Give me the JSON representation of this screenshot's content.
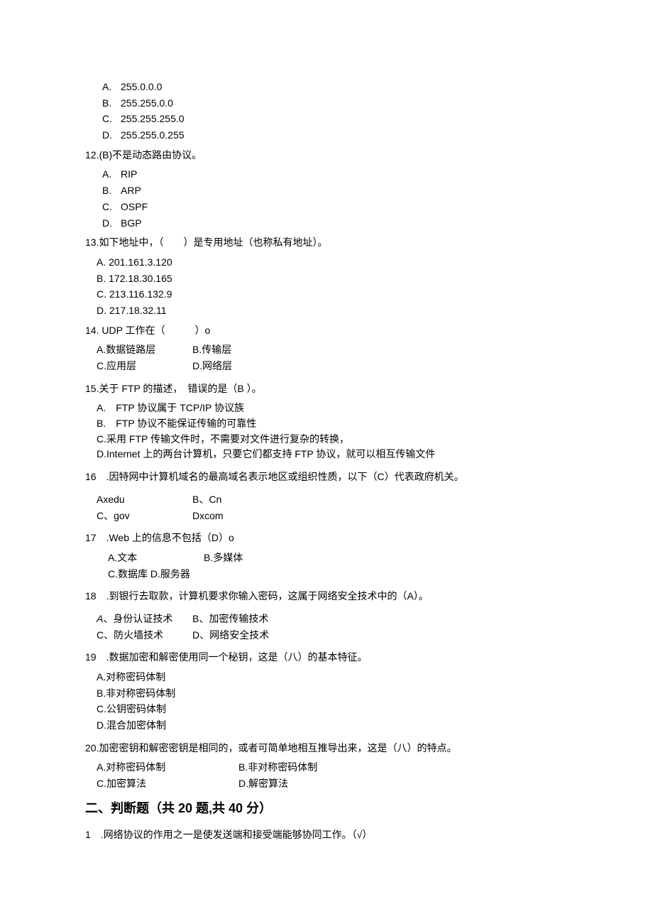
{
  "q11": {
    "opts": {
      "A": "255.0.0.0",
      "B": "255.255.0.0",
      "C": "255.255.255.0",
      "D": "255.255.0.255"
    }
  },
  "q12": {
    "stem": "12.(B)不是动态路由协议。",
    "opts": {
      "A": "RIP",
      "B": "ARP",
      "C": "OSPF",
      "D": "BGP"
    }
  },
  "q13": {
    "stem": "13.如下地址中，（　　）是专用地址（也称私有地址）。",
    "opts": {
      "A": "A. 201.161.3.120",
      "B": "B. 172.18.30.165",
      "C": "C. 213.116.132.9",
      "D": "D. 217.18.32.11"
    }
  },
  "q14": {
    "stem": "14. UDP 工作在（　　　）o",
    "row1a": "A.数据链路层",
    "row1b": "B.传输层",
    "row2a": "C.应用层",
    "row2b": "D.网络层"
  },
  "q15": {
    "stem": "15.关于 FTP 的描述，　错误的是（B ）。",
    "A": "A.　FTP 协议属于 TCP/IP 协议族",
    "B": "B.　FTP 协议不能保证传输的可靠性",
    "C": "C.采用 FTP 传输文件时，不需要对文件进行复杂的转换，",
    "D": "D.Internet 上的两台计算机，只要它们都支持 FTP 协议，就可以相互传输文件"
  },
  "q16": {
    "stem": "16 .因特网中计算机域名的最高域名表示地区或组织性质，以下（C）代表政府机关。",
    "row1a": "Axedu",
    "row1b": "B、Cn",
    "row2a": "C、gov",
    "row2b": "Dxcom"
  },
  "q17": {
    "stem": "17 .Web 上的信息不包括（D）o",
    "row1a": "A.文本",
    "row1b": "B.多媒体",
    "row2": "C.数据库 D.服务器"
  },
  "q18": {
    "stem": "18 .到银行去取款，计算机要求你输入密码，这属于网络安全技术中的（A）。",
    "row1a_letter": "A",
    "row1a_text": "、身份认证技术",
    "row1b": "B、加密传输技术",
    "row2a": "C、防火墙技术",
    "row2b": "D、网络安全技术"
  },
  "q19": {
    "stem": "19 .数据加密和解密使用同一个秘钥，这是（八）的基本特征。",
    "A": "A.对称密码体制",
    "B": "B.非对称密码体制",
    "C": "C.公钥密码体制",
    "D": "D.混合加密体制"
  },
  "q20": {
    "stem": "20.加密密钥和解密密钥是相同的，或者可简单地相互推导出来，这是（八）的特点。",
    "row1a": "A.对称密码体制",
    "row1b": "B.非对称密码体制",
    "row2a": "C.加密算法",
    "row2b": "D.解密算法"
  },
  "sec2": {
    "heading": "二、判断题（共 20 题,共 40 分）",
    "q1": "1 .网络协议的作用之一是使发送端和接受端能够协同工作。（√）"
  },
  "letters": {
    "A": "A.",
    "B": "B.",
    "C": "C.",
    "D": "D."
  }
}
